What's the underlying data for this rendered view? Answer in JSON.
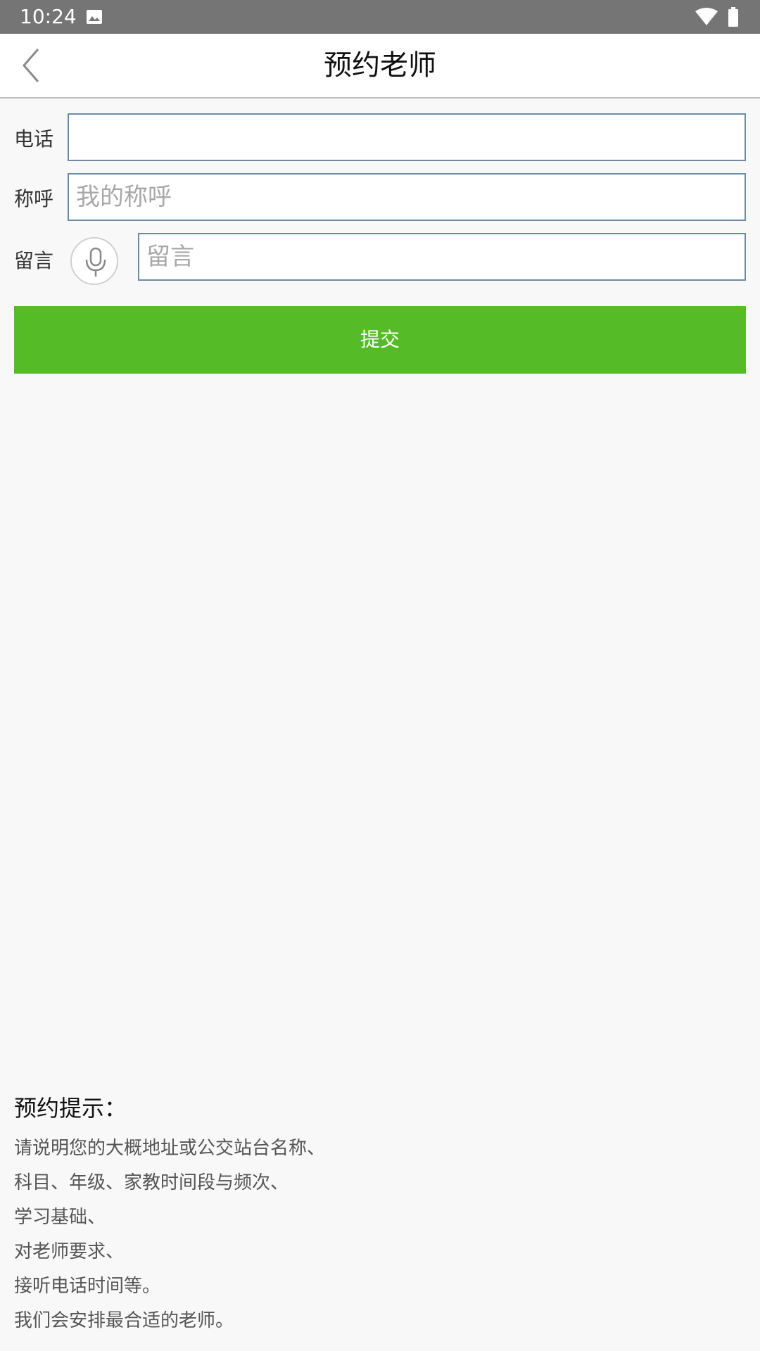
{
  "status_bar": {
    "time": "10:24",
    "icons": [
      "image-icon",
      "wifi-icon",
      "battery-icon"
    ]
  },
  "app_bar": {
    "title": "预约老师",
    "back_icon": "chevron-left-icon"
  },
  "form": {
    "phone": {
      "label": "电话",
      "value": "",
      "placeholder": ""
    },
    "name": {
      "label": "称呼",
      "value": "",
      "placeholder": "我的称呼"
    },
    "message": {
      "label": "留言",
      "value": "",
      "placeholder": "留言",
      "voice_icon": "microphone-icon"
    },
    "submit_label": "提交"
  },
  "tips": {
    "title": "预约提示：",
    "lines": [
      "请说明您的大概地址或公交站台名称、",
      "科目、年级、家教时间段与频次、",
      "学习基础、",
      "对老师要求、",
      "接听电话时间等。",
      "我们会安排最合适的老师。"
    ]
  },
  "colors": {
    "status_bar": "#757575",
    "submit_button": "#55bb26",
    "field_border": "#6b8ba8",
    "background": "#f8f8f8"
  }
}
